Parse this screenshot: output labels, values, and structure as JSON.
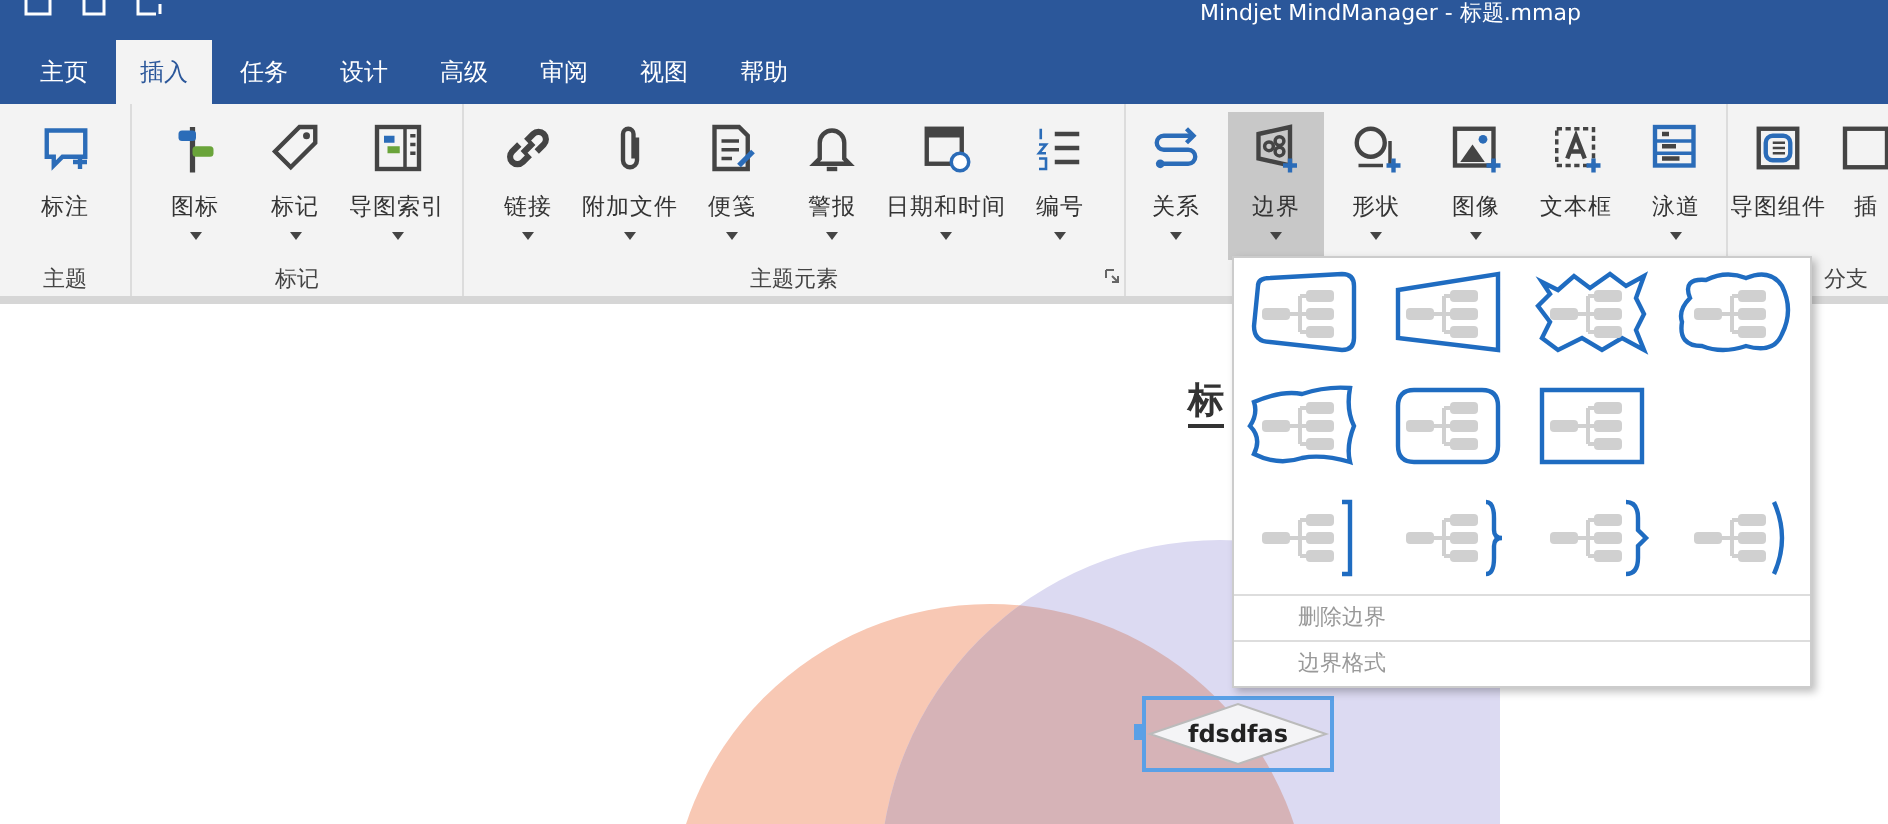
{
  "window": {
    "title": "Mindjet MindManager - 标题.mmap"
  },
  "tabs": [
    {
      "label": "主页",
      "selected": false
    },
    {
      "label": "插入",
      "selected": true
    },
    {
      "label": "任务",
      "selected": false
    },
    {
      "label": "设计",
      "selected": false
    },
    {
      "label": "高级",
      "selected": false
    },
    {
      "label": "审阅",
      "selected": false
    },
    {
      "label": "视图",
      "selected": false
    },
    {
      "label": "帮助",
      "selected": false
    }
  ],
  "ribbon_groups": [
    {
      "label": "主题",
      "buttons": [
        {
          "label": "标注",
          "dropdown": false,
          "selected": false
        }
      ]
    },
    {
      "label": "标记",
      "buttons": [
        {
          "label": "图标",
          "dropdown": true,
          "selected": false
        },
        {
          "label": "标记",
          "dropdown": true,
          "selected": false
        },
        {
          "label": "导图索引",
          "dropdown": true,
          "selected": false
        }
      ]
    },
    {
      "label": "主题元素",
      "launcher": true,
      "buttons": [
        {
          "label": "链接",
          "dropdown": true,
          "selected": false
        },
        {
          "label": "附加文件",
          "dropdown": true,
          "selected": false
        },
        {
          "label": "便笺",
          "dropdown": true,
          "selected": false
        },
        {
          "label": "警报",
          "dropdown": true,
          "selected": false
        },
        {
          "label": "日期和时间",
          "dropdown": true,
          "selected": false
        },
        {
          "label": "编号",
          "dropdown": true,
          "selected": false
        }
      ]
    },
    {
      "buttons": [
        {
          "label": "关系",
          "dropdown": true,
          "selected": false
        },
        {
          "label": "边界",
          "dropdown": true,
          "selected": true
        },
        {
          "label": "形状",
          "dropdown": true,
          "selected": false
        },
        {
          "label": "图像",
          "dropdown": true,
          "selected": false
        },
        {
          "label": "文本框",
          "dropdown": false,
          "selected": false
        },
        {
          "label": "泳道",
          "dropdown": true,
          "selected": false
        }
      ]
    },
    {
      "label": "分支",
      "buttons": [
        {
          "label": "导图组件",
          "dropdown": false,
          "selected": false
        },
        {
          "label": "插",
          "dropdown": false,
          "selected": false
        }
      ]
    }
  ],
  "canvas": {
    "title": "标",
    "node": "fdsdfas"
  },
  "boundary_menu": {
    "gallery": [
      [
        {
          "kind": "rounded-trapezoid"
        },
        {
          "kind": "trapezoid"
        },
        {
          "kind": "zigzag"
        },
        {
          "kind": "cloud"
        }
      ],
      [
        {
          "kind": "wavy"
        },
        {
          "kind": "rounded-rect"
        },
        {
          "kind": "rect"
        }
      ],
      [
        {
          "kind": "bracket"
        },
        {
          "kind": "brace"
        },
        {
          "kind": "curly"
        },
        {
          "kind": "parenthesis"
        }
      ]
    ],
    "items": [
      {
        "label": "删除边界",
        "disabled": true
      },
      {
        "label": "边界格式",
        "disabled": true
      }
    ]
  }
}
